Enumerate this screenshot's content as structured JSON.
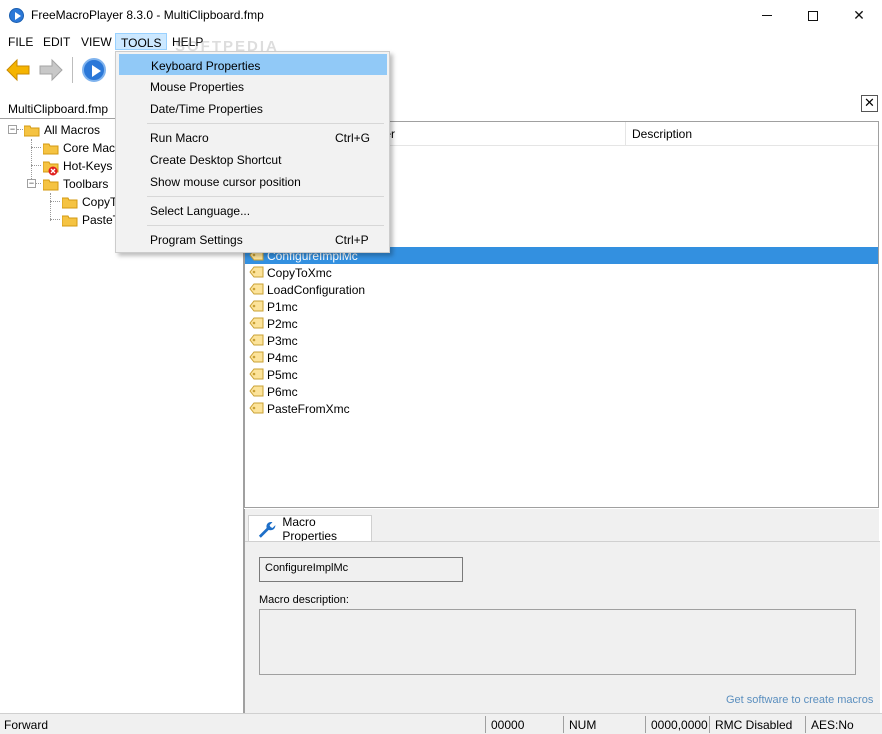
{
  "window": {
    "title": "FreeMacroPlayer 8.3.0 - MultiClipboard.fmp"
  },
  "menubar": {
    "items": [
      "FILE",
      "EDIT",
      "VIEW",
      "TOOLS",
      "HELP"
    ]
  },
  "watermark": "SOFTPEDIA",
  "left_panel": {
    "tab_label": "MultiClipboard.fmp",
    "tree": {
      "root": "All Macros",
      "core": "Core Mac",
      "hotkeys": "Hot-Keys",
      "toolbars": "Toolbars",
      "copy": "CopyT",
      "paste": "PasteT"
    }
  },
  "list": {
    "columns": {
      "trigger": "gger",
      "description": "Description"
    },
    "rows": [
      "ConfigureImplMc",
      "CopyToXmc",
      "LoadConfiguration",
      "P1mc",
      "P2mc",
      "P3mc",
      "P4mc",
      "P5mc",
      "P6mc",
      "PasteFromXmc"
    ],
    "selected": "ConfigureImplMc"
  },
  "properties": {
    "tab_label": "Macro Properties",
    "name_value": "ConfigureImplMc",
    "description_label": "Macro description:",
    "description_value": "",
    "footer_link": "Get software to create macros"
  },
  "tools_menu": {
    "items": [
      {
        "label": "Keyboard Properties",
        "shortcut": ""
      },
      {
        "label": "Mouse Properties",
        "shortcut": ""
      },
      {
        "label": "Date/Time Properties",
        "shortcut": ""
      },
      {
        "label": "Run Macro",
        "shortcut": "Ctrl+G"
      },
      {
        "label": "Create Desktop Shortcut",
        "shortcut": ""
      },
      {
        "label": "Show mouse cursor position",
        "shortcut": ""
      },
      {
        "label": "Select Language...",
        "shortcut": ""
      },
      {
        "label": "Program Settings",
        "shortcut": "Ctrl+P"
      }
    ],
    "highlighted": "Keyboard Properties"
  },
  "statusbar": {
    "mode": "Forward",
    "counter": "00000",
    "num": "NUM",
    "coords": "0000,0000",
    "rmc": "RMC Disabled",
    "aes": "AES:No"
  },
  "colors": {
    "selection": "#3390e0",
    "menu_highlight": "#91c9f7",
    "accent_blue": "#2b78d8",
    "link": "#5b8fbf"
  }
}
